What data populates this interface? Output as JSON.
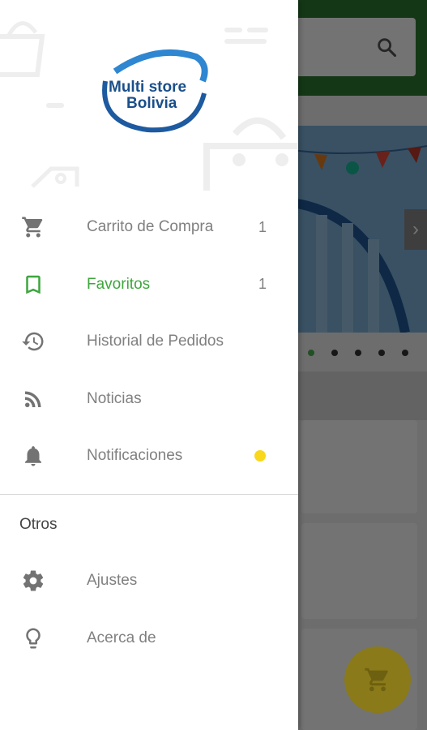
{
  "app": {
    "brand": "Multi store Bolivia",
    "brand_line1": "Multi store",
    "brand_line2": "Bolivia",
    "colors": {
      "primary_green": "#2e7d32",
      "selected_green": "#3da63d",
      "accent_yellow": "#f9d71c",
      "logo_blue": "#1a4f8a"
    }
  },
  "drawer": {
    "items": [
      {
        "label": "Carrito de Compra",
        "icon": "cart-icon",
        "count": "1"
      },
      {
        "label": "Favoritos",
        "icon": "bookmark-icon",
        "count": "1",
        "selected": true
      },
      {
        "label": "Historial de Pedidos",
        "icon": "history-icon"
      },
      {
        "label": "Noticias",
        "icon": "rss-icon"
      },
      {
        "label": "Notificaciones",
        "icon": "bell-icon",
        "badge": "yellow-dot"
      }
    ],
    "section_title": "Otros",
    "other_items": [
      {
        "label": "Ajustes",
        "icon": "gear-icon"
      },
      {
        "label": "Acerca de",
        "icon": "lightbulb-icon"
      }
    ]
  },
  "background": {
    "banner_dots": 5,
    "active_dot": 0
  }
}
